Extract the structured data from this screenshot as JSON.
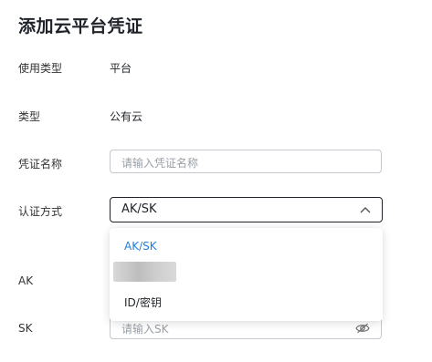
{
  "page": {
    "title": "添加云平台凭证"
  },
  "form": {
    "usage_type": {
      "label": "使用类型",
      "value": "平台"
    },
    "type": {
      "label": "类型",
      "value": "公有云"
    },
    "credential_name": {
      "label": "凭证名称",
      "placeholder": "请输入凭证名称"
    },
    "auth_method": {
      "label": "认证方式",
      "selected": "AK/SK"
    },
    "ak": {
      "label": "AK"
    },
    "sk": {
      "label": "SK",
      "placeholder": "请输入SK"
    }
  },
  "dropdown": {
    "options": [
      {
        "label": "AK/SK",
        "selected": true
      },
      {
        "label": "",
        "redacted": true
      },
      {
        "label": "ID/密钥",
        "selected": false
      }
    ]
  },
  "colors": {
    "accent": "#1e7ee6",
    "border": "#c4c8ce",
    "text": "#1f2329",
    "placeholder": "#9aa0a6"
  },
  "icons": {
    "select_chevron": "chevron-up-icon",
    "password_toggle": "eye-off-icon"
  }
}
